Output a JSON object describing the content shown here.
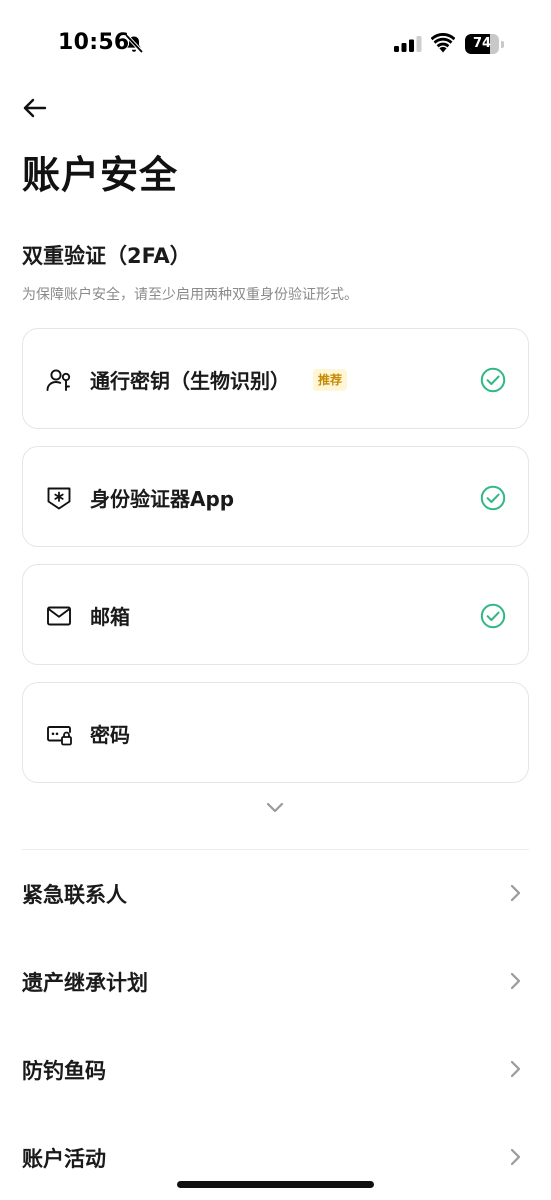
{
  "status_bar": {
    "time": "10:56",
    "battery_percent": 74,
    "battery_label": "74"
  },
  "header": {
    "title": "账户安全"
  },
  "two_factor": {
    "title": "双重验证（2FA）",
    "description": "为保障账户安全，请至少启用两种双重身份验证形式。",
    "methods": [
      {
        "label": "通行密钥（生物识别）",
        "badge": "推荐",
        "icon": "passkey-person-icon",
        "enabled": true
      },
      {
        "label": "身份验证器App",
        "icon": "authenticator-shield-icon",
        "enabled": true
      },
      {
        "label": "邮箱",
        "icon": "mail-icon",
        "enabled": true
      },
      {
        "label": "密码",
        "icon": "password-lock-icon",
        "enabled": false
      }
    ]
  },
  "settings_list": [
    {
      "label": "紧急联系人"
    },
    {
      "label": "遗产继承计划"
    },
    {
      "label": "防钓鱼码"
    },
    {
      "label": "账户活动"
    }
  ],
  "colors": {
    "check_green": "#2fb884",
    "badge_text": "#c58a00",
    "badge_bg": "#fff6d6",
    "card_border": "#e6e6e6"
  }
}
